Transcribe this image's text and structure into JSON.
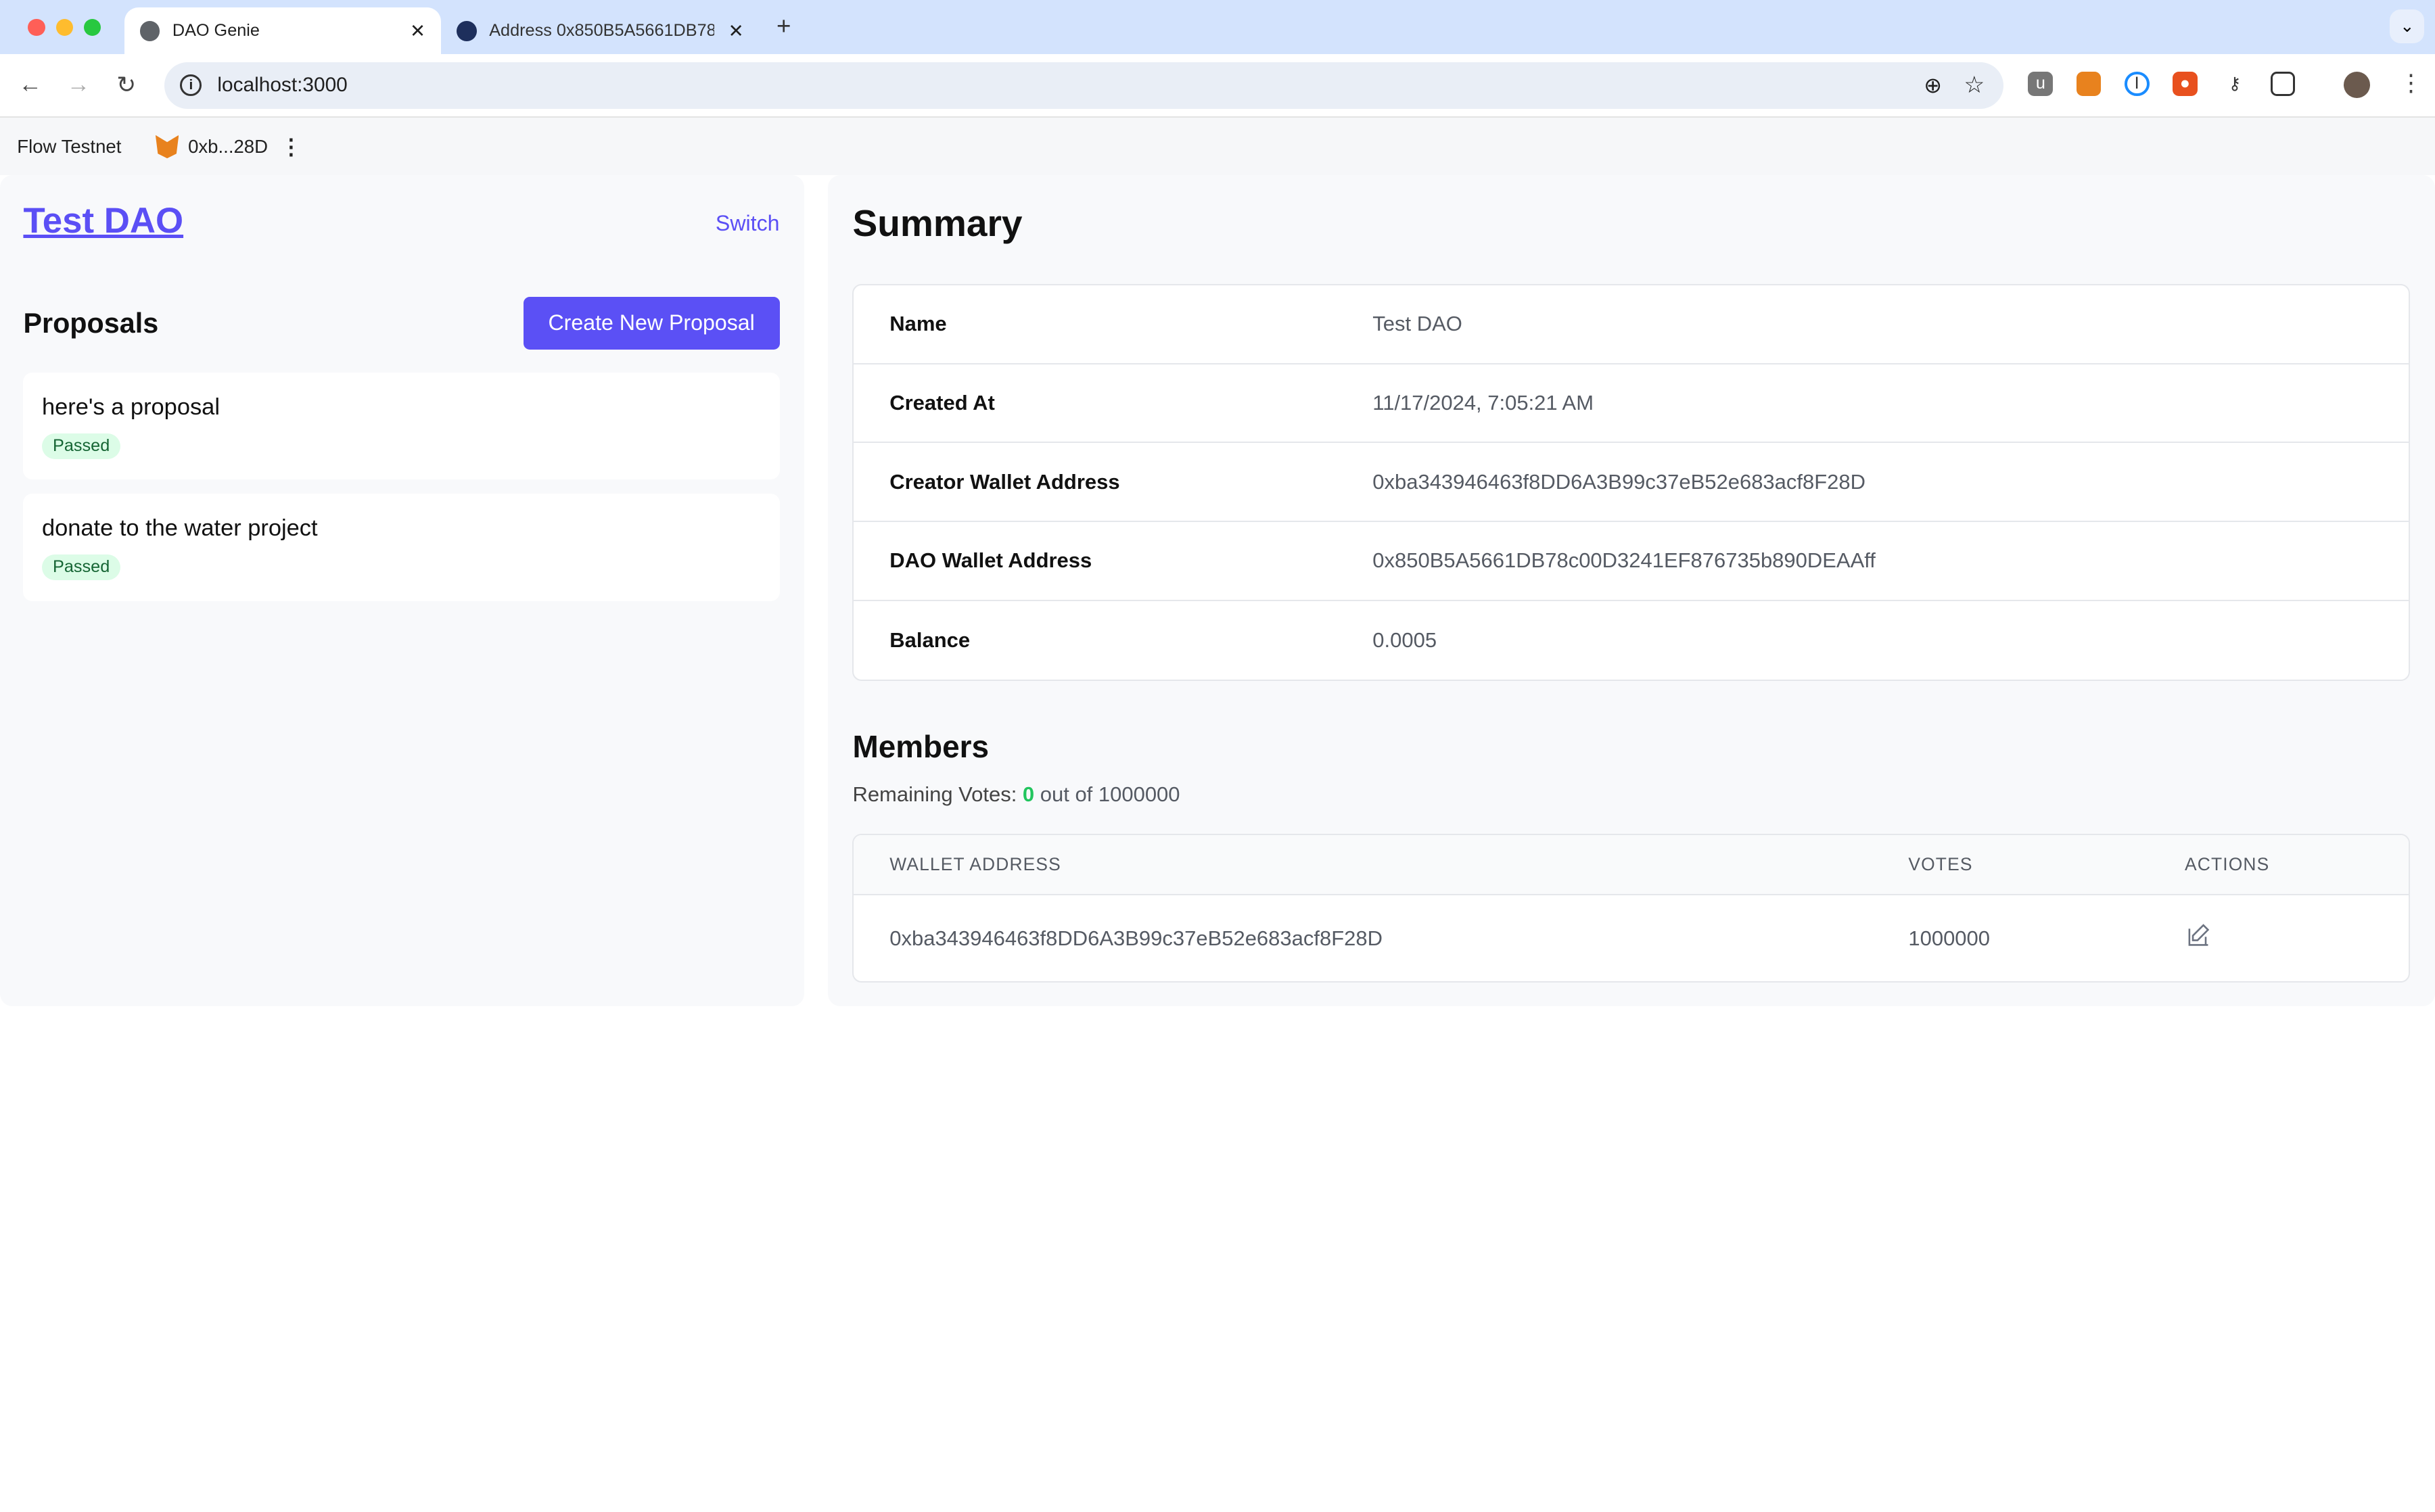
{
  "browser": {
    "tabs": [
      {
        "title": "DAO Genie",
        "active": true,
        "icon": "globe-icon"
      },
      {
        "title": "Address 0x850B5A5661DB78",
        "active": false,
        "icon": "blockscout-icon"
      }
    ],
    "url": "localhost:3000",
    "extensions": [
      "ublock-icon",
      "metamask-icon",
      "onepassword-icon",
      "privacy-lock-icon",
      "key-off-icon",
      "puzzle-icon"
    ]
  },
  "topbar": {
    "network": "Flow Testnet",
    "account": "0xb...28D"
  },
  "sidebar": {
    "dao_name": "Test DAO",
    "switch_label": "Switch",
    "proposals_heading": "Proposals",
    "create_label": "Create New Proposal",
    "proposals": [
      {
        "title": "here's a proposal",
        "status": "Passed"
      },
      {
        "title": "donate to the water project",
        "status": "Passed"
      }
    ]
  },
  "summary": {
    "heading": "Summary",
    "rows": [
      {
        "label": "Name",
        "value": "Test DAO"
      },
      {
        "label": "Created At",
        "value": "11/17/2024, 7:05:21 AM"
      },
      {
        "label": "Creator Wallet Address",
        "value": "0xba343946463f8DD6A3B99c37eB52e683acf8F28D"
      },
      {
        "label": "DAO Wallet Address",
        "value": "0x850B5A5661DB78c00D3241EF876735b890DEAAff"
      },
      {
        "label": "Balance",
        "value": "0.0005"
      }
    ]
  },
  "members": {
    "heading": "Members",
    "remaining_label": "Remaining Votes:",
    "remaining_value": "0",
    "out_of": "out of 1000000",
    "columns": [
      "WALLET ADDRESS",
      "VOTES",
      "ACTIONS"
    ],
    "rows": [
      {
        "address": "0xba343946463f8DD6A3B99c37eB52e683acf8F28D",
        "votes": "1000000",
        "action_icon": "edit-icon"
      }
    ]
  },
  "colors": {
    "accent": "#5b50f5",
    "success": "#22c55e",
    "badge_bg": "#dcfce7"
  }
}
